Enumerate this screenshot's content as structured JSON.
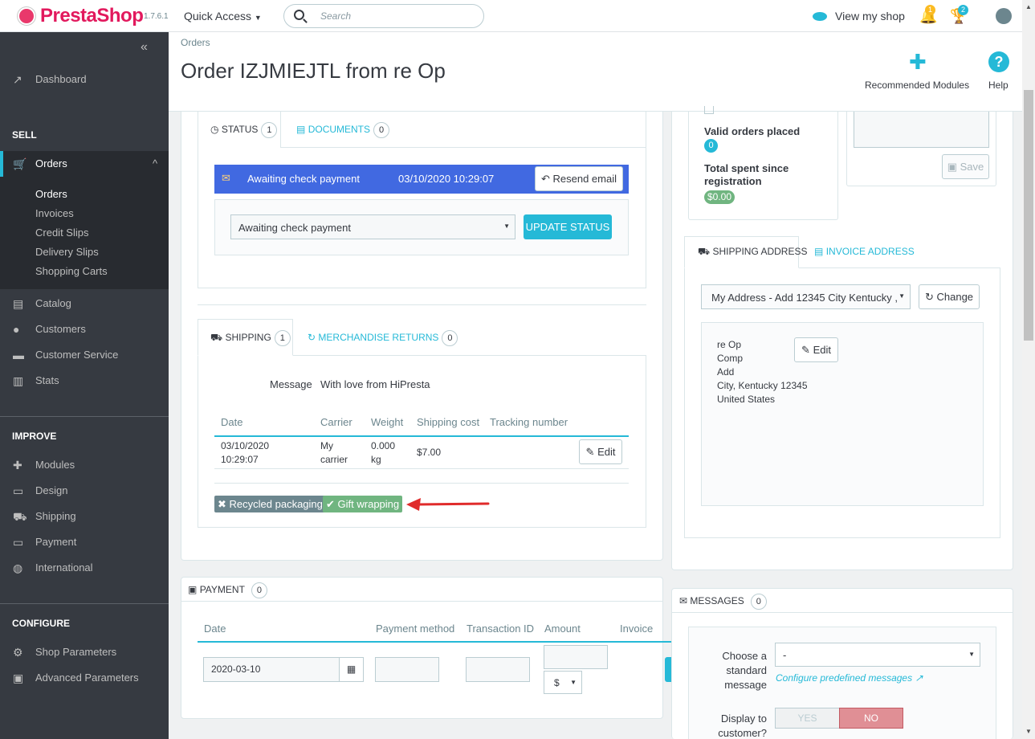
{
  "brand": {
    "name": "PrestaShop",
    "version": "1.7.6.1"
  },
  "topbar": {
    "quick_access": "Quick Access",
    "search_placeholder": "Search",
    "view_shop": "View my shop",
    "notif_count": "1",
    "trophy_count": "2"
  },
  "sidebar": {
    "dashboard": "Dashboard",
    "sell": "SELL",
    "orders": "Orders",
    "orders_sub": [
      "Orders",
      "Invoices",
      "Credit Slips",
      "Delivery Slips",
      "Shopping Carts"
    ],
    "catalog": "Catalog",
    "customers": "Customers",
    "customer_service": "Customer Service",
    "stats": "Stats",
    "improve": "IMPROVE",
    "modules": "Modules",
    "design": "Design",
    "shipping": "Shipping",
    "payment": "Payment",
    "international": "International",
    "configure": "CONFIGURE",
    "shop_parameters": "Shop Parameters",
    "advanced_parameters": "Advanced Parameters"
  },
  "header": {
    "breadcrumb": "Orders",
    "title": "Order IZJMIEJTL from re Op",
    "recommended_modules": "Recommended Modules",
    "help": "Help"
  },
  "status_panel": {
    "tab_status": "STATUS",
    "status_count": "1",
    "tab_documents": "DOCUMENTS",
    "documents_count": "0",
    "current_status": "Awaiting check payment",
    "current_date": "03/10/2020 10:29:07",
    "resend_email": "Resend email",
    "select_value": "Awaiting check payment",
    "update_status": "UPDATE STATUS"
  },
  "shipping_panel": {
    "tab_shipping": "SHIPPING",
    "shipping_count": "1",
    "tab_returns": "MERCHANDISE RETURNS",
    "returns_count": "0",
    "message_label": "Message",
    "message_value": "With love from HiPresta",
    "columns": [
      "Date",
      "Carrier",
      "Weight",
      "Shipping cost",
      "Tracking number"
    ],
    "row": {
      "date1": "03/10/2020",
      "date2": "10:29:07",
      "carrier1": "My",
      "carrier2": "carrier",
      "weight1": "0.000",
      "weight2": "kg",
      "cost": "$7.00"
    },
    "edit": "Edit",
    "recycled": "Recycled packaging",
    "gift": "Gift wrapping"
  },
  "payment_panel": {
    "title": "PAYMENT",
    "count": "0",
    "columns": [
      "Date",
      "Payment method",
      "Transaction ID",
      "Amount",
      "Invoice"
    ],
    "date_value": "2020-03-10",
    "currency": "$"
  },
  "customer_panel": {
    "valid_orders_label": "Valid orders placed",
    "valid_orders": "0",
    "total_spent_label1": "Total spent since",
    "total_spent_label2": "registration",
    "total_spent": "$0.00",
    "save": "Save"
  },
  "address_panel": {
    "tab_shipping": "SHIPPING ADDRESS",
    "tab_invoice": "INVOICE ADDRESS",
    "select_value": "My Address - Add 12345 City Kentucky ,",
    "change": "Change",
    "lines": [
      "re Op",
      "Comp",
      "Add",
      "City, Kentucky 12345",
      "United States"
    ],
    "edit": "Edit"
  },
  "messages_panel": {
    "title": "MESSAGES",
    "count": "0",
    "choose_label": [
      "Choose a",
      "standard",
      "message"
    ],
    "select_value": "-",
    "configure_link": "Configure predefined messages",
    "display_label": [
      "Display to",
      "customer?"
    ],
    "yes": "YES",
    "no": "NO"
  },
  "colors": {
    "accent": "#25b9d7",
    "status_bar": "#4169e1",
    "success": "#70b580",
    "danger": "#e08f95",
    "sidebar": "#363a41"
  }
}
